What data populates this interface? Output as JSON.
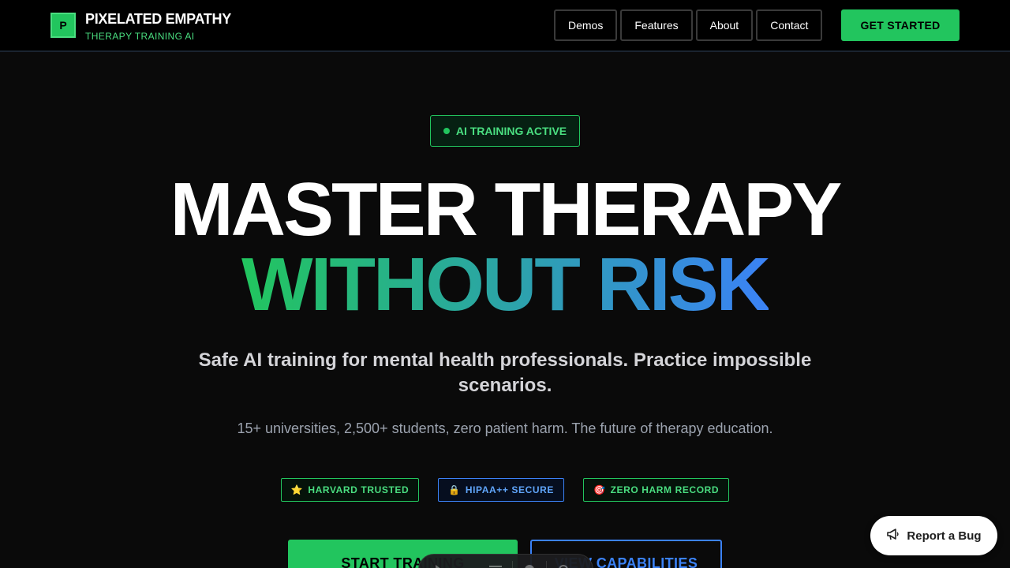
{
  "brand": {
    "logo_letter": "P",
    "name": "PIXELATED EMPATHY",
    "subtitle": "THERAPY TRAINING AI"
  },
  "nav": {
    "links": [
      "Demos",
      "Features",
      "About",
      "Contact"
    ],
    "cta": "GET STARTED"
  },
  "hero": {
    "status": "AI TRAINING ACTIVE",
    "title_line1": "MASTER THERAPY",
    "title_line2": "WITHOUT RISK",
    "subtitle": "Safe AI training for mental health professionals. Practice impossible scenarios.",
    "tagline": "15+ universities, 2,500+ students, zero patient harm. The future of therapy education.",
    "badges": [
      {
        "icon": "⭐",
        "label": "HARVARD TRUSTED",
        "color": "green"
      },
      {
        "icon": "🔒",
        "label": "HIPAA++ SECURE",
        "color": "blue"
      },
      {
        "icon": "🎯",
        "label": "ZERO HARM RECORD",
        "color": "green"
      }
    ],
    "primary_button": "START TRAINING",
    "secondary_button": "VIEW CAPABILITIES"
  },
  "report_bug": {
    "label": "Report a Bug",
    "icon": "megaphone-icon"
  },
  "colors": {
    "accent_green": "#22c55e",
    "accent_blue": "#3b82f6",
    "background": "#0a0a0a"
  }
}
